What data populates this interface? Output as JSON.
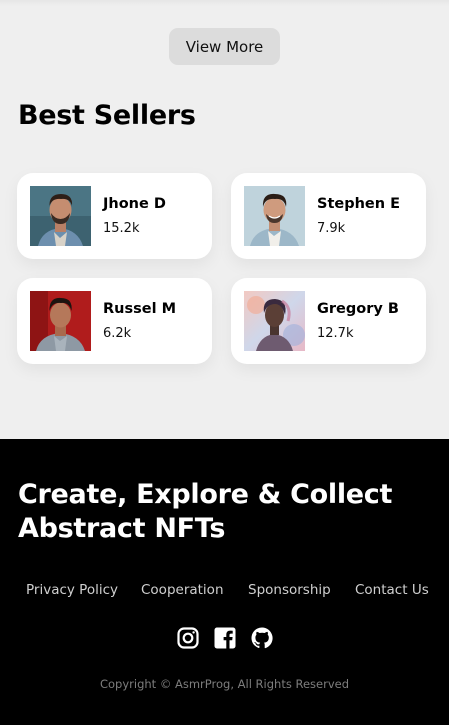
{
  "actions": {
    "view_more_label": "View More"
  },
  "best_sellers": {
    "title": "Best Sellers",
    "sellers": [
      {
        "name": "Jhone D",
        "count": "15.2k"
      },
      {
        "name": "Stephen E",
        "count": "7.9k"
      },
      {
        "name": "Russel M",
        "count": "6.2k"
      },
      {
        "name": "Gregory B",
        "count": "12.7k"
      }
    ]
  },
  "footer": {
    "headline_line1": "Create, Explore & Collect",
    "headline_line2": "Abstract NFTs",
    "links": [
      "Privacy Policy",
      "Cooperation",
      "Sponsorship",
      "Contact Us"
    ],
    "social_icons": [
      "instagram-icon",
      "facebook-icon",
      "github-icon"
    ],
    "copyright": "Copyright © AsmrProg, All Rights Reserved"
  },
  "colors": {
    "page_background": "#efefef",
    "card_background": "#ffffff",
    "button_background": "#dcdcdc",
    "footer_background": "#000000",
    "footer_link": "#cfcfcf",
    "copyright_text": "#7d7d7d"
  }
}
